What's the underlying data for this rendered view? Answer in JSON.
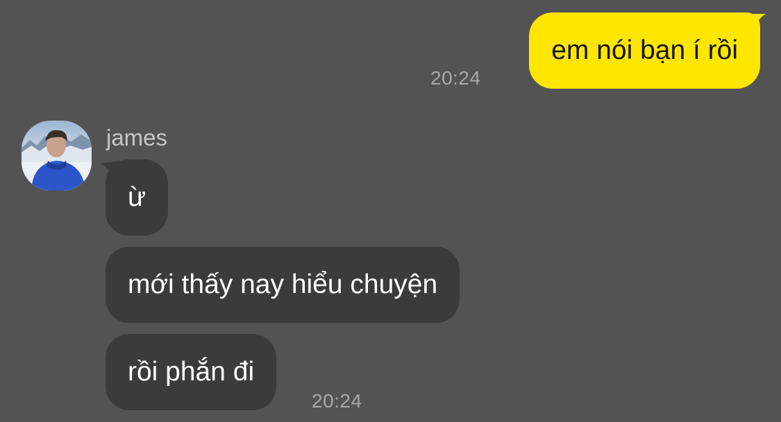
{
  "conversation": {
    "outgoing": [
      {
        "text": "em nói bạn í rồi",
        "time": "20:24"
      }
    ],
    "incoming": {
      "sender": "james",
      "avatar_icon": "user-photo-avatar",
      "messages": [
        {
          "text": "ừ"
        },
        {
          "text": "mới thấy nay hiểu chuyện"
        },
        {
          "text": "rồi phắn đi",
          "time": "20:24"
        }
      ]
    }
  },
  "colors": {
    "background": "#545354",
    "incoming_bubble": "#3b3a3c",
    "outgoing_bubble": "#ffe600",
    "timestamp": "#a8a7a9"
  }
}
